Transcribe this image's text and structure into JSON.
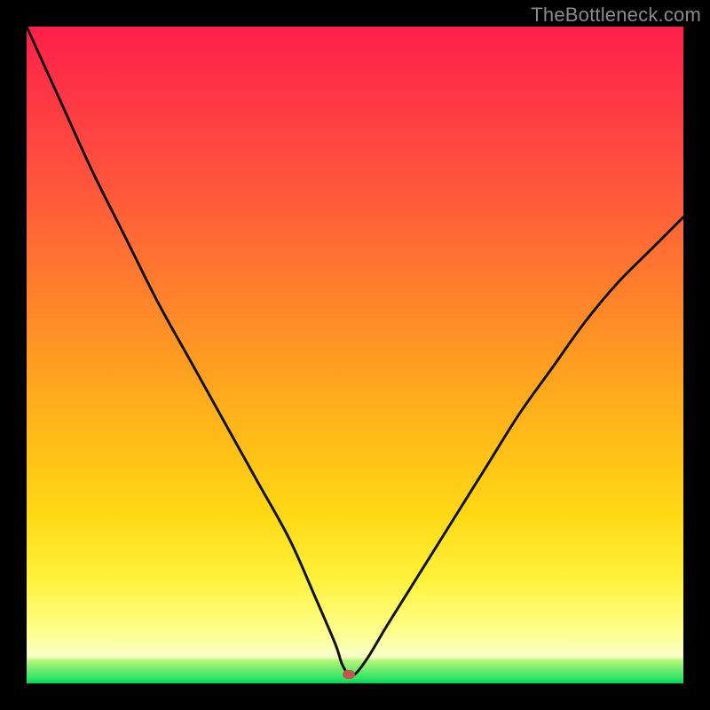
{
  "watermark": {
    "text": "TheBottleneck.com"
  },
  "colors": {
    "curve": "#111111",
    "marker": "#c5564d",
    "frame": "#000000"
  },
  "chart_data": {
    "type": "line",
    "title": "",
    "xlabel": "",
    "ylabel": "",
    "xlim": [
      0,
      100
    ],
    "ylim": [
      0,
      100
    ],
    "grid": false,
    "legend": false,
    "annotations": [
      {
        "kind": "marker",
        "x": 49,
        "y": 1.4,
        "shape": "rounded-rect",
        "color": "#c5564d"
      }
    ],
    "series": [
      {
        "name": "bottleneck-curve",
        "x": [
          0,
          5,
          10,
          15,
          20,
          25,
          30,
          35,
          40,
          44,
          47,
          48,
          49,
          50,
          52,
          55,
          60,
          65,
          70,
          75,
          80,
          85,
          90,
          95,
          100
        ],
        "values": [
          100,
          89,
          78,
          68,
          58,
          49,
          40,
          31,
          22,
          13,
          6,
          3,
          1.4,
          1.4,
          4,
          9,
          17,
          25,
          33,
          41,
          48,
          55,
          61,
          66,
          71
        ]
      }
    ],
    "background_gradient": {
      "stops": [
        {
          "pos": 0.0,
          "color": "#ff1f4b"
        },
        {
          "pos": 0.5,
          "color": "#ff9a22"
        },
        {
          "pos": 0.84,
          "color": "#fff23a"
        },
        {
          "pos": 0.96,
          "color": "#f8ffc8"
        },
        {
          "pos": 0.985,
          "color": "#2fe567"
        },
        {
          "pos": 1.0,
          "color": "#06d35a"
        }
      ]
    }
  }
}
